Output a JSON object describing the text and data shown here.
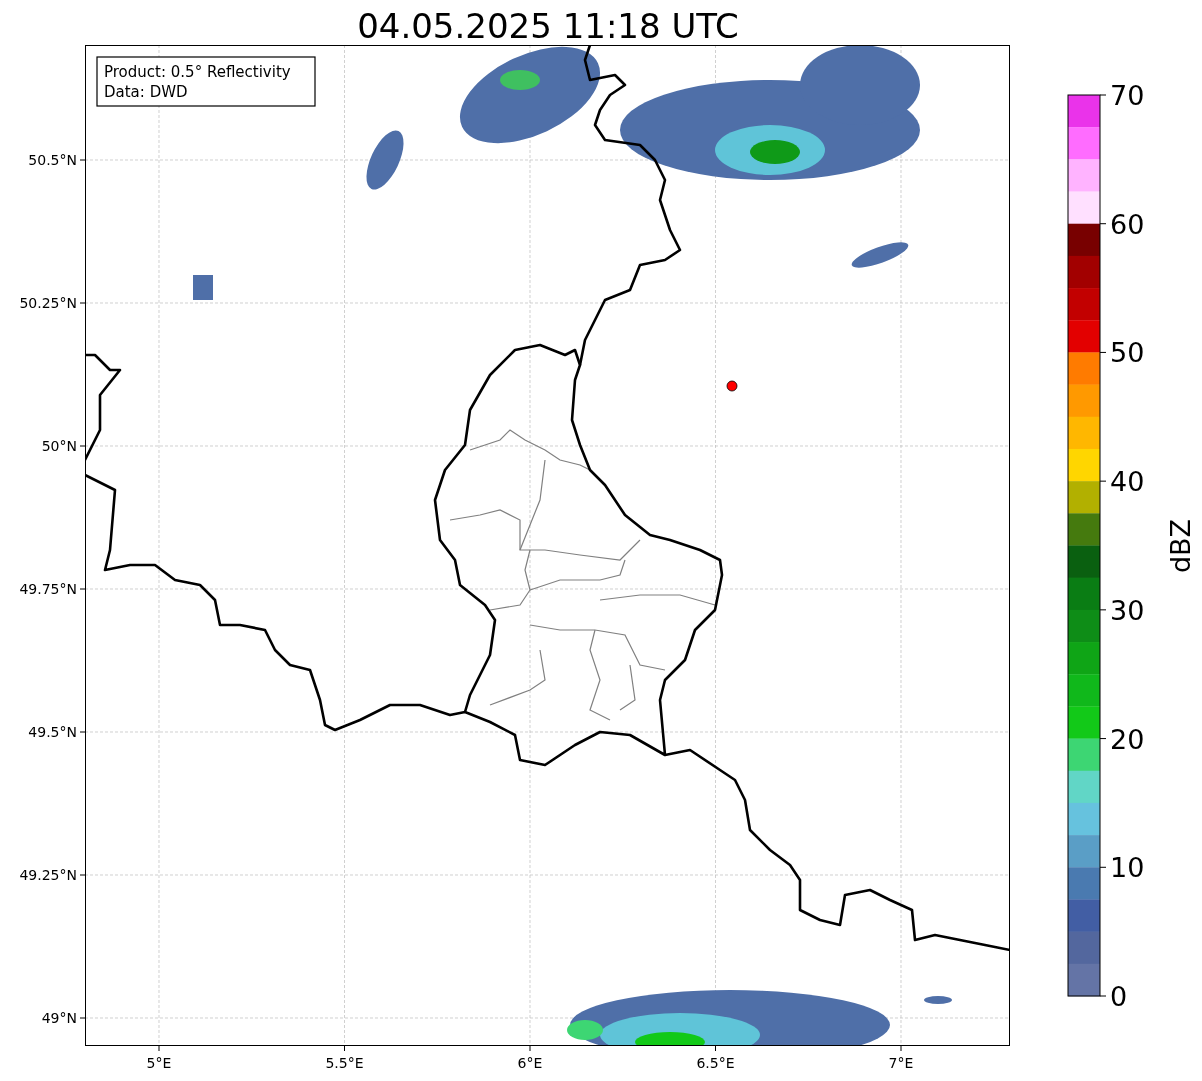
{
  "title": "04.05.2025 11:18 UTC",
  "info_box": {
    "lines": [
      "Product: 0.5° Reflectivity",
      "Data: DWD"
    ]
  },
  "map": {
    "xticks": [
      "5°E",
      "5.5°E",
      "6°E",
      "6.5°E",
      "7°E"
    ],
    "yticks": [
      "50.5°N",
      "50.25°N",
      "50°N",
      "49.75°N",
      "49.5°N",
      "49.25°N",
      "49°N"
    ]
  },
  "colorbar": {
    "label": "dBZ",
    "ticks": [
      "70",
      "60",
      "50",
      "40",
      "30",
      "20",
      "10",
      "0"
    ],
    "bins": [
      {
        "color": "#ea33ea"
      },
      {
        "color": "#ff6cff"
      },
      {
        "color": "#ffb3ff"
      },
      {
        "color": "#ffe0ff"
      },
      {
        "color": "#780000"
      },
      {
        "color": "#a20000"
      },
      {
        "color": "#c20000"
      },
      {
        "color": "#e30000"
      },
      {
        "color": "#ff7b00"
      },
      {
        "color": "#ff9900"
      },
      {
        "color": "#ffb700"
      },
      {
        "color": "#ffd600"
      },
      {
        "color": "#b2b000"
      },
      {
        "color": "#457a0e"
      },
      {
        "color": "#0a6010"
      },
      {
        "color": "#0a7d14"
      },
      {
        "color": "#0e8d17"
      },
      {
        "color": "#0fa516"
      },
      {
        "color": "#10b81b"
      },
      {
        "color": "#12c918"
      },
      {
        "color": "#3dd673"
      },
      {
        "color": "#61d6c6"
      },
      {
        "color": "#66c2de"
      },
      {
        "color": "#5a9ec6"
      },
      {
        "color": "#4a7ab0"
      },
      {
        "color": "#425ea4"
      },
      {
        "color": "#53679e"
      },
      {
        "color": "#6474a6"
      }
    ]
  }
}
